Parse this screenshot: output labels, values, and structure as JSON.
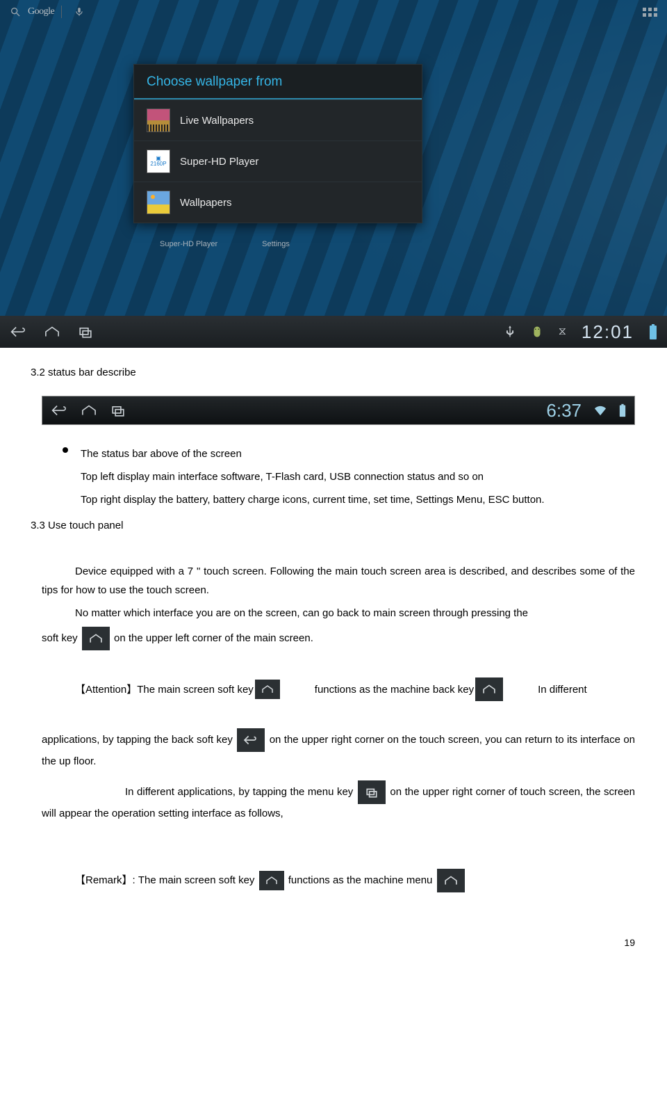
{
  "tablet": {
    "search_label": "Google",
    "dialog_title": "Choose wallpaper from",
    "options": [
      {
        "label": "Live Wallpapers",
        "icon": "live"
      },
      {
        "label": "Super-HD Player",
        "icon": "player"
      },
      {
        "label": "Wallpapers",
        "icon": "wall"
      }
    ],
    "desktop_labels": [
      "Super-HD Player",
      "Settings"
    ],
    "clock": "12:01"
  },
  "statusbar2_clock": "6:37",
  "doc": {
    "h_32": "3.2 status bar describe",
    "bullet_title": "The status bar above of the screen",
    "bullet_line1": "Top left display main interface software, T-Flash card, USB connection status and so on",
    "bullet_line2": "Top right display the battery, battery charge icons, current time, set time, Settings Menu, ESC button.",
    "h_33": "3.3 Use touch panel",
    "p1": "Device equipped with a 7 \" touch screen. Following the main touch screen area is described, and describes some of the tips for how to use the touch screen.",
    "p2a": "No matter which interface you are on the screen, can go back to main screen through pressing the",
    "p2b_pre": "soft key ",
    "p2b_post": " on the upper left corner of the main screen.",
    "att_pre": "【Attention】The main screen soft key ",
    "att_mid": "functions as the machine back key",
    "att_tail": " In different",
    "back_pre": "applications, by tapping the back soft key ",
    "back_post": "on the upper right corner on the touch screen, you can return to its interface on the up floor.",
    "menu_pre": "In different applications, by tapping the menu key ",
    "menu_post": "on the upper right corner of touch screen, the screen will appear the operation setting interface as follows,",
    "remark_pre": "【Remark】: The main screen soft key ",
    "remark_post": "functions as the machine menu"
  },
  "page_number": "19"
}
